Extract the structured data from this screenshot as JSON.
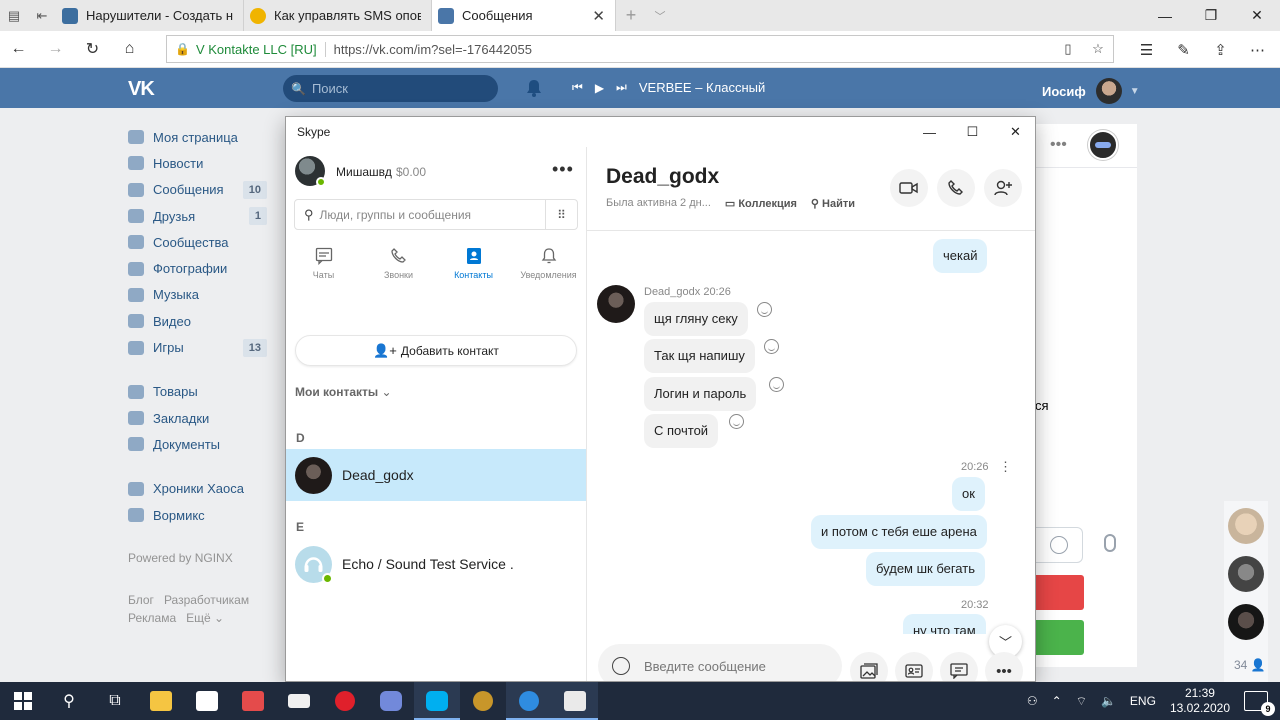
{
  "browser": {
    "tabs": [
      {
        "title": "Нарушители - Создать нов",
        "favicon_color": "#3c6e9f"
      },
      {
        "title": "Как управлять SMS оповещ",
        "favicon_color": "#f0b400"
      },
      {
        "title": "Сообщения",
        "favicon_color": "#4a76a8"
      }
    ],
    "cert_label": "V Kontakte LLC [RU]",
    "url": "https://vk.com/im?sel=-176442055"
  },
  "vk": {
    "logo": "VK",
    "search_placeholder": "Поиск",
    "now_playing": "VERBEE – Классный",
    "user_name": "Иосиф",
    "menu": [
      {
        "label": "Моя страница",
        "count": ""
      },
      {
        "label": "Новости",
        "count": ""
      },
      {
        "label": "Сообщения",
        "count": "10"
      },
      {
        "label": "Друзья",
        "count": "1"
      },
      {
        "label": "Сообщества",
        "count": ""
      },
      {
        "label": "Фотографии",
        "count": ""
      },
      {
        "label": "Музыка",
        "count": ""
      },
      {
        "label": "Видео",
        "count": ""
      },
      {
        "label": "Игры",
        "count": "13"
      }
    ],
    "menu2": [
      {
        "label": "Товары"
      },
      {
        "label": "Закладки"
      },
      {
        "label": "Документы"
      }
    ],
    "menu3": [
      {
        "label": "Хроники Хаоса"
      },
      {
        "label": "Вормикс"
      }
    ],
    "powered": "Powered by NGINX",
    "footer": [
      "Блог",
      "Разработчикам",
      "Реклама",
      "Ещё"
    ],
    "partial_text": "ся",
    "online_count": "34"
  },
  "skype": {
    "title": "Skype",
    "me": {
      "name": "Мишашвд",
      "credit": "$0.00"
    },
    "search_placeholder": "Люди, группы и сообщения",
    "tabs": [
      {
        "label": "Чаты"
      },
      {
        "label": "Звонки"
      },
      {
        "label": "Контакты"
      },
      {
        "label": "Уведомления"
      }
    ],
    "add_contact": "Добавить контакт",
    "my_contacts": "Мои контакты",
    "groups": [
      {
        "letter": "D",
        "contacts": [
          {
            "name": "Dead_godx"
          }
        ]
      },
      {
        "letter": "E",
        "contacts": [
          {
            "name": "Echo / Sound Test Service ."
          }
        ]
      }
    ],
    "chat": {
      "name": "Dead_godx",
      "status": "Была активна 2 дн...",
      "collection": "Коллекция",
      "find": "Найти",
      "peer_meta": "Dead_godx 20:26",
      "messages": [
        {
          "dir": "out",
          "text": "чекай"
        },
        {
          "dir": "in",
          "text": "щя гляну секу"
        },
        {
          "dir": "in",
          "text": "Так щя напишу"
        },
        {
          "dir": "in",
          "text": "Логин и пароль"
        },
        {
          "dir": "in",
          "text": "С почтой"
        },
        {
          "dir": "out",
          "text": "ок"
        },
        {
          "dir": "out",
          "text": "и потом с тебя еше арена"
        },
        {
          "dir": "out",
          "text": "будем шк бегать"
        },
        {
          "dir": "out",
          "text": "ну что там"
        }
      ],
      "time1": "20:26",
      "time2": "20:32",
      "compose_placeholder": "Введите сообщение"
    }
  },
  "taskbar": {
    "lang": "ENG",
    "time": "21:39",
    "date": "13.02.2020",
    "notifications": "9"
  }
}
